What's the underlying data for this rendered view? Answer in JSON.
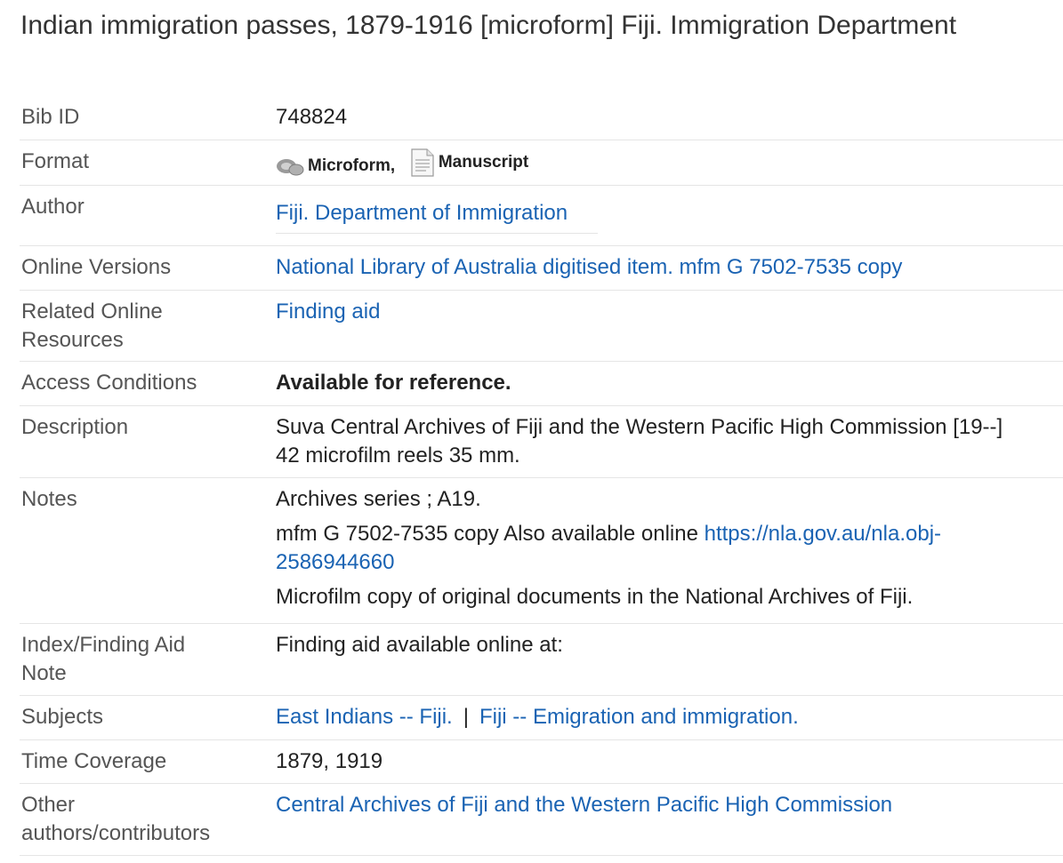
{
  "title": "Indian immigration passes, 1879-1916 [microform] Fiji. Immigration Department",
  "fields": {
    "bib_id": {
      "label": "Bib ID",
      "value": "748824"
    },
    "format": {
      "label": "Format",
      "items": [
        {
          "label": "Microform,",
          "icon": "microform-icon"
        },
        {
          "label": "Manuscript",
          "icon": "manuscript-icon"
        }
      ]
    },
    "author": {
      "label": "Author",
      "link": "Fiji. Department of Immigration"
    },
    "online_versions": {
      "label": "Online Versions",
      "link": "National Library of Australia digitised item. mfm G 7502-7535 copy"
    },
    "related_resources": {
      "label_line1": "Related Online",
      "label_line2": "Resources",
      "link": "Finding aid"
    },
    "access": {
      "label": "Access Conditions",
      "value": "Available for reference."
    },
    "description": {
      "label": "Description",
      "line1": "Suva Central Archives of Fiji and the Western Pacific High Commission [19--]",
      "line2": "42 microfilm reels 35 mm."
    },
    "notes": {
      "label": "Notes",
      "note1": "Archives series ; A19.",
      "note2_text": "mfm G 7502-7535 copy Also available online ",
      "note2_link_line1": "https://nla.gov.au/nla.obj-",
      "note2_link_line2": "2586944660",
      "note3": "Microfilm copy of original documents in the National Archives of Fiji."
    },
    "index_note": {
      "label_line1": "Index/Finding Aid",
      "label_line2": "Note",
      "value": "Finding aid available online at:"
    },
    "subjects": {
      "label": "Subjects",
      "items": [
        "East Indians -- Fiji.",
        "Fiji -- Emigration and immigration."
      ],
      "separator": "|"
    },
    "time_coverage": {
      "label": "Time Coverage",
      "value": "1879, 1919"
    },
    "other_authors": {
      "label_line1": "Other",
      "label_line2": "authors/contributors",
      "link": "Central Archives of Fiji and the Western Pacific High Commission"
    }
  }
}
